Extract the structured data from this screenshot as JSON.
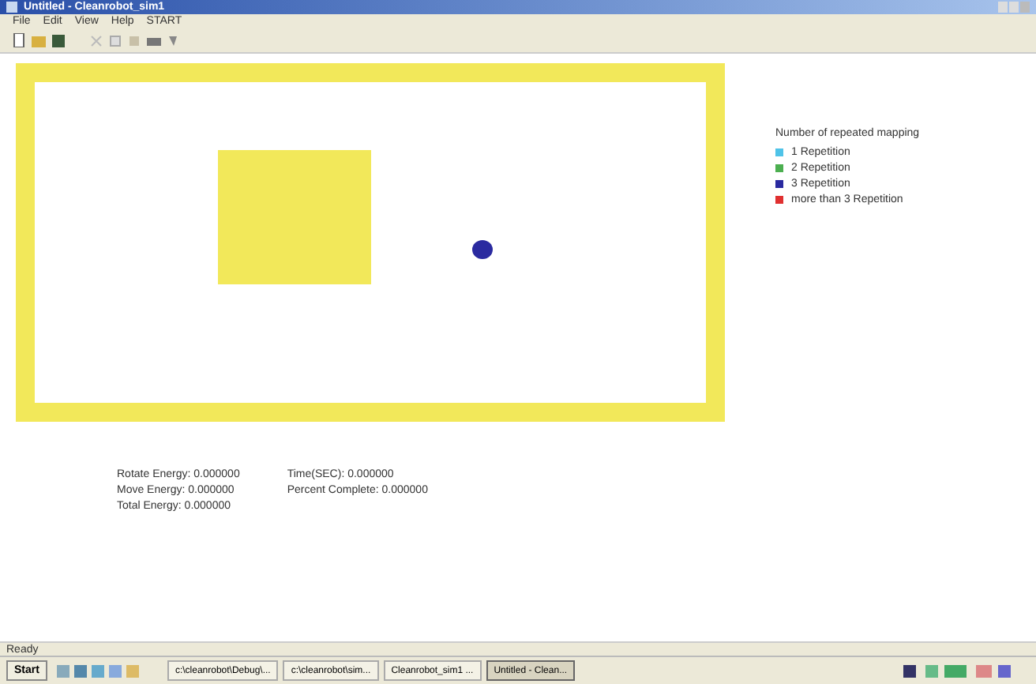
{
  "window": {
    "title": "Untitled - Cleanrobot_sim1"
  },
  "menu": [
    "File",
    "Edit",
    "View",
    "Help",
    "START"
  ],
  "legend": {
    "title": "Number of repeated mapping",
    "items": [
      {
        "label": "1 Repetition",
        "color": "#4fc3e8"
      },
      {
        "label": "2 Repetition",
        "color": "#4caf50"
      },
      {
        "label": "3 Repetition",
        "color": "#2a2aa0"
      },
      {
        "label": "more than 3 Repetition",
        "color": "#e03030"
      }
    ]
  },
  "stats": {
    "left": [
      "Rotate Energy: 0.000000",
      "Move Energy: 0.000000",
      "Total Energy: 0.000000"
    ],
    "right": [
      "Time(SEC): 0.000000",
      "Percent Complete: 0.000000"
    ]
  },
  "status_bar": "Ready",
  "taskbar": {
    "start": "Start",
    "tasks": [
      {
        "label": "c:\\cleanrobot\\Debug\\...",
        "selected": false
      },
      {
        "label": "c:\\cleanrobot\\sim...",
        "selected": false
      },
      {
        "label": "Cleanrobot_sim1 ...",
        "selected": false
      },
      {
        "label": "Untitled - Clean...",
        "selected": true
      }
    ]
  }
}
